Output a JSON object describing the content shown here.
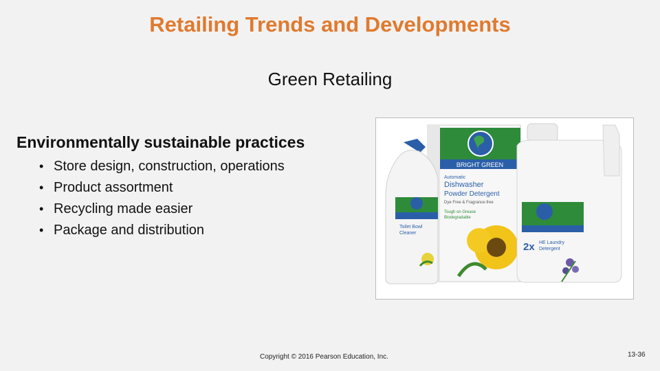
{
  "slide": {
    "title": "Retailing Trends and Developments",
    "subtitle": "Green Retailing",
    "heading": "Environmentally sustainable practices",
    "bullets": [
      "Store design, construction, operations",
      "Product assortment",
      "Recycling made easier",
      "Package and distribution"
    ],
    "bullet_glyph": "•",
    "copyright": "Copyright © 2016 Pearson Education, Inc.",
    "slide_number": "13-36"
  },
  "photo": {
    "brand": "BRIGHT GREEN",
    "box_text": [
      "Automatic",
      "Dishwasher",
      "Powder Detergent",
      "Dye Free & Fragrance-free",
      "Tough on Grease",
      "Biodegradable"
    ],
    "bottle_left_text": [
      "Toilet Bowl",
      "Cleaner"
    ],
    "jug_text": [
      "2x",
      "HE Laundry",
      "Detergent"
    ]
  },
  "colors": {
    "title": "#e07a2e",
    "brand_green": "#2e8b3a",
    "brand_blue": "#2a5fa8",
    "background": "#f2f2f2"
  }
}
